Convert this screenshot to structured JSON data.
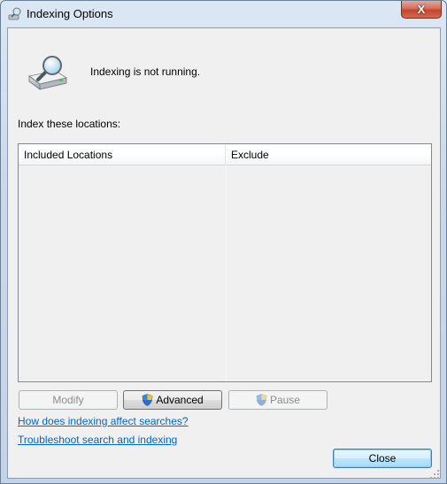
{
  "window": {
    "title": "Indexing Options",
    "close_glyph": "X"
  },
  "icons": {
    "title": "indexing-magnifier-icon",
    "hero": "hard-drive-magnifier-icon",
    "shield": "uac-shield-icon"
  },
  "status": {
    "text": "Indexing is not running."
  },
  "locations": {
    "label": "Index these locations:",
    "columns": [
      "Included Locations",
      "Exclude"
    ],
    "rows": []
  },
  "buttons": {
    "modify": "Modify",
    "advanced": "Advanced",
    "pause": "Pause",
    "close": "Close"
  },
  "links": {
    "affect": "How does indexing affect searches?",
    "troubleshoot": "Troubleshoot search and indexing"
  },
  "colors": {
    "link": "#0066cc",
    "close_button": "#c2452c",
    "focus_button": "#3c7fb1"
  }
}
